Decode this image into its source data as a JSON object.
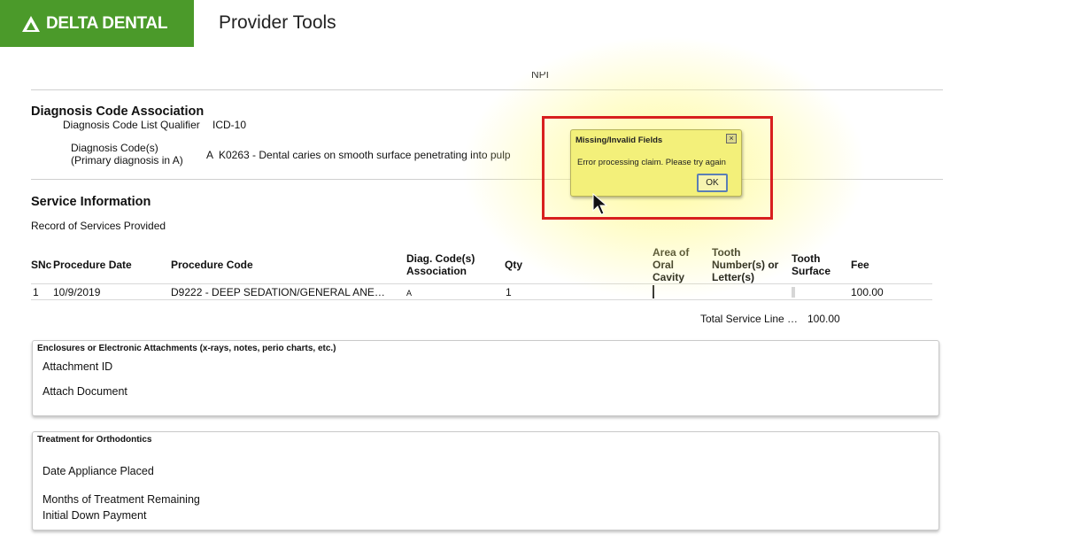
{
  "header": {
    "logo_text": "DELTA DENTAL",
    "app_title": "Provider Tools"
  },
  "provider": {
    "npi_label": "NPI"
  },
  "diagnosis": {
    "title": "Diagnosis Code Association",
    "qualifier_label": "Diagnosis Code List Qualifier",
    "qualifier_value": "ICD-10",
    "codes_label_1": "Diagnosis Code(s)",
    "codes_label_2": "(Primary diagnosis in A)",
    "code_letter": "A",
    "code_value": "K0263 - Dental caries on smooth surface penetrating into pulp"
  },
  "service": {
    "title": "Service Information",
    "subtitle": "Record of Services Provided",
    "columns": {
      "sn": "SNc",
      "date": "Procedure Date",
      "code": "Procedure Code",
      "diag_1": "Diag. Code(s)",
      "diag_2": "Association",
      "qty": "Qty",
      "area_1": "Area of",
      "area_2": "Oral",
      "area_3": "Cavity",
      "tooth_1": "Tooth",
      "tooth_2": "Number(s) or",
      "tooth_3": "Letter(s)",
      "surface_1": "Tooth",
      "surface_2": "Surface",
      "fee": "Fee"
    },
    "rows": [
      {
        "sn": "1",
        "date": "10/9/2019",
        "code": "D9222 - DEEP SEDATION/GENERAL ANE…",
        "diag": "A",
        "qty": "1",
        "fee": "100.00"
      }
    ],
    "total_label": "Total Service Line …",
    "total_value": "100.00"
  },
  "enclosures": {
    "title": "Enclosures or Electronic Attachments (x-rays, notes, perio charts, etc.)",
    "attachment_id_label": "Attachment ID",
    "attach_document_label": "Attach Document"
  },
  "orthodontics": {
    "title": "Treatment for Orthodontics",
    "date_label": "Date Appliance Placed",
    "months_label": "Months of Treatment Remaining",
    "down_payment_label": "Initial Down Payment"
  },
  "dialog": {
    "title": "Missing/Invalid Fields",
    "message": "Error processing claim. Please try again",
    "ok_label": "OK",
    "close_symbol": "×"
  },
  "colors": {
    "brand_green": "#4b9a2a",
    "highlight_red": "#d81f1f",
    "dialog_yellow": "#f3f07a"
  }
}
